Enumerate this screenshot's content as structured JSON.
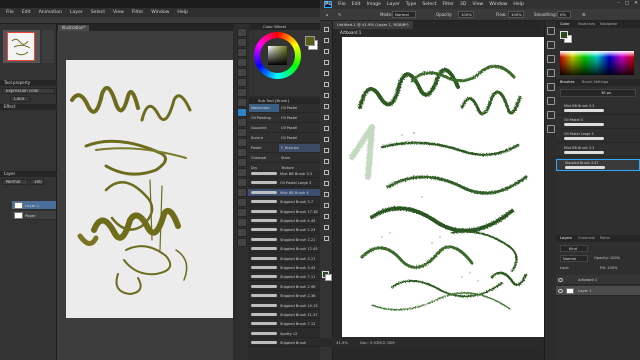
{
  "left_app": {
    "menu": [
      "File",
      "Edit",
      "Animation",
      "Layer",
      "Select",
      "View",
      "Filter",
      "Window",
      "Help"
    ],
    "doc_tab": "Illustration*",
    "subtool_panel_title": "Sub Tool [Brush]",
    "color_panel_title": "Color Wheel",
    "tool_property_title": "Tool property",
    "expression_color_label": "Expression color",
    "expression_color_value": "Color",
    "effect_label": "Effect",
    "layer_panel_title": "Layer",
    "layers": [
      "Layer 1",
      "Paper"
    ],
    "layer_mode": "Normal",
    "layer_opacity": "100",
    "subtool_groups": [
      "Watercolor",
      "Oil Painting",
      "Gouache",
      "Sumi-e",
      "Pastel",
      "Charcoal",
      "Dry"
    ],
    "brush_names": [
      "Oil Pastel",
      "Oil Pastel",
      "Oil Pastel",
      "Oil Pastel",
      "F_Hisauka",
      "Stam",
      "Texture"
    ],
    "brush_list": [
      "Mixt BB Brush 3.3",
      "Oil Pastel Large 3",
      "Mixt BB Brush 4",
      "Stippled Brush 3.7",
      "Stippled Brush 17.38",
      "Stippled Brush 4.45",
      "Stippled Brush 2.23",
      "Stippled Brush 2.21",
      "Stippled Brush 12.45",
      "Stippled Brush 3.17",
      "Stippled Brush 3.45",
      "Stippled Brush 7.11",
      "Stippled Brush 2.98",
      "Stippled Brush 2.36",
      "Stippled Brush 10.15",
      "Stippled Brush 11.37",
      "Stippled Brush 7.12",
      "Spotty 12",
      "Stippled Brush"
    ],
    "brush_selected_index": 2,
    "color_fg": "#5b5c1a"
  },
  "right_app": {
    "menu": [
      "File",
      "Edit",
      "Image",
      "Layer",
      "Type",
      "Select",
      "Filter",
      "3D",
      "View",
      "Window",
      "Help"
    ],
    "logo": "Ps",
    "options": {
      "mode_label": "Mode:",
      "mode_value": "Normal",
      "opacity_label": "Opacity:",
      "opacity_value": "100%",
      "flow_label": "Flow:",
      "flow_value": "100%",
      "smoothing_label": "Smoothing:",
      "smoothing_value": "0%"
    },
    "doc_tab": "Untitled-1 @ 41.9% (Layer 1, RGB/8*)",
    "artboard_label": "Artboard 1",
    "status_zoom": "41.9%",
    "status_doc": "Doc: 5.93M/2.30M",
    "color_tabs": [
      "Color",
      "Swatches",
      "Navigator"
    ],
    "brushes_tabs": [
      "Brushes",
      "Brush Settings"
    ],
    "brush_size": "36 px",
    "brushes": [
      "Mixt BB Brush 3.3",
      "Oil Pastel 3",
      "Oil Pastel Large 3",
      "Mixt BB Brush 3.3",
      "Stippled Brush 3.47"
    ],
    "brush_selected_index": 4,
    "layers_tabs": [
      "Layers",
      "Channels",
      "Paths"
    ],
    "layer_kind": "Kind",
    "layer_mode": "Normal",
    "layer_opacity": "Opacity: 100%",
    "layer_fill": "Fill: 100%",
    "lock_label": "Lock:",
    "layers": [
      "Artboard 1",
      "Layer 1"
    ],
    "color_fg": "#2b4a1f"
  }
}
